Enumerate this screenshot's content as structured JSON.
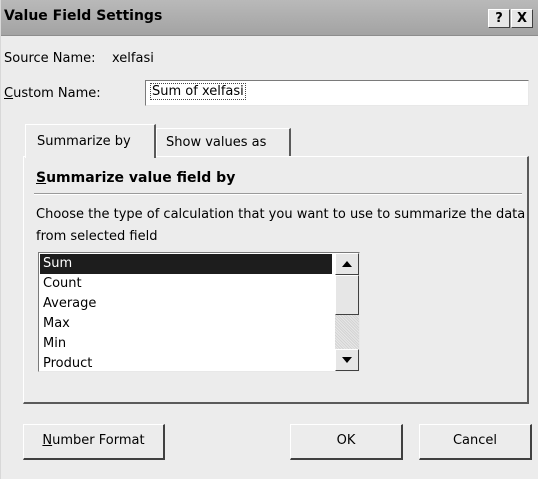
{
  "window": {
    "title": "Value Field Settings",
    "help_label": "?",
    "close_label": "X"
  },
  "source": {
    "label": "Source Name:",
    "value": "xelfasi"
  },
  "custom_name": {
    "label_mnemonic": "C",
    "label_rest": "ustom Name:",
    "value": "Sum of xelfasi"
  },
  "tabs": [
    {
      "label": "Summarize by",
      "active": true
    },
    {
      "label": "Show values as",
      "active": false
    }
  ],
  "summarize": {
    "heading_mnemonic": "S",
    "heading_rest": "ummarize value field by",
    "description": "Choose the type of calculation that you want to use to summarize the data from selected field",
    "items": [
      "Sum",
      "Count",
      "Average",
      "Max",
      "Min",
      "Product"
    ],
    "selected": "Sum"
  },
  "buttons": {
    "number_format_mnemonic": "N",
    "number_format_rest": "umber Format",
    "ok": "OK",
    "cancel": "Cancel"
  },
  "colors": {
    "selection": "#1d1d1d",
    "dialog_bg": "#ececec"
  }
}
